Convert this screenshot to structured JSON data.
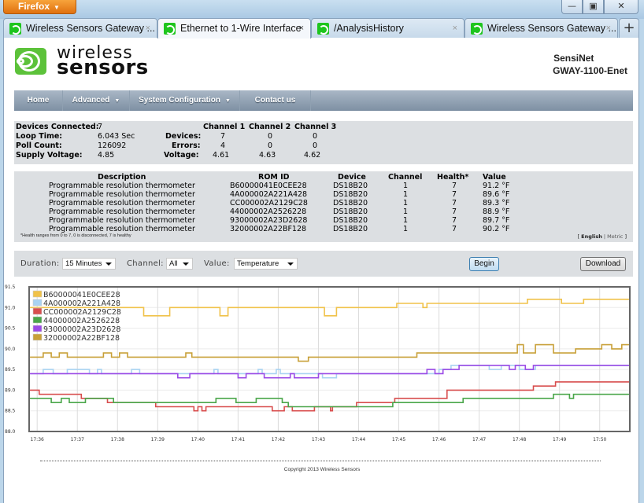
{
  "browser": {
    "app_button": "Firefox",
    "window_controls": {
      "minimize": "▭",
      "maximize": "□",
      "close": "✕"
    },
    "tabs": [
      {
        "title": "Wireless Sensors Gateway ...",
        "active": false
      },
      {
        "title": "Ethernet to 1-Wire Interface",
        "active": true
      },
      {
        "title": "/AnalysisHistory",
        "active": false
      },
      {
        "title": "Wireless Sensors Gateway ...",
        "active": false
      }
    ],
    "tab_close": "×",
    "new_tab": "+"
  },
  "header": {
    "logo_line1": "wireless",
    "logo_line2": "sensors",
    "product": "SensiNet",
    "model": "GWAY-1100-Enet"
  },
  "nav": {
    "items": [
      {
        "label": "Home",
        "dropdown": false
      },
      {
        "label": "Advanced",
        "dropdown": true
      },
      {
        "label": "System Configuration",
        "dropdown": true
      },
      {
        "label": "Contact us",
        "dropdown": false
      }
    ],
    "caret": "▼"
  },
  "status": {
    "devices_connected_label": "Devices Connected:",
    "devices_connected": "7",
    "loop_time_label": "Loop Time:",
    "loop_time": "6.043 Sec",
    "poll_count_label": "Poll Count:",
    "poll_count": "126092",
    "supply_voltage_label": "Supply Voltage:",
    "supply_voltage": "4.85",
    "channel_headers": [
      "Channel 1",
      "Channel 2",
      "Channel 3"
    ],
    "row_labels": {
      "devices": "Devices:",
      "errors": "Errors:",
      "voltage": "Voltage:"
    },
    "channels": [
      {
        "devices": "7",
        "errors": "4",
        "voltage": "4.61"
      },
      {
        "devices": "0",
        "errors": "0",
        "voltage": "4.63"
      },
      {
        "devices": "0",
        "errors": "0",
        "voltage": "4.62"
      }
    ]
  },
  "devices_table": {
    "headers": {
      "description": "Description",
      "rom_id": "ROM ID",
      "device": "Device",
      "channel": "Channel",
      "health": "Health*",
      "value": "Value"
    },
    "rows": [
      {
        "description": "Programmable resolution thermometer",
        "rom_id": "B60000041E0CEE28",
        "device": "DS18B20",
        "channel": "1",
        "health": "7",
        "value": "91.2 °F"
      },
      {
        "description": "Programmable resolution thermometer",
        "rom_id": "4A000002A221A428",
        "device": "DS18B20",
        "channel": "1",
        "health": "7",
        "value": "89.6 °F"
      },
      {
        "description": "Programmable resolution thermometer",
        "rom_id": "CC000002A2129C28",
        "device": "DS18B20",
        "channel": "1",
        "health": "7",
        "value": "89.3 °F"
      },
      {
        "description": "Programmable resolution thermometer",
        "rom_id": "44000002A2526228",
        "device": "DS18B20",
        "channel": "1",
        "health": "7",
        "value": "88.9 °F"
      },
      {
        "description": "Programmable resolution thermometer",
        "rom_id": "93000002A23D2628",
        "device": "DS18B20",
        "channel": "1",
        "health": "7",
        "value": "89.7 °F"
      },
      {
        "description": "Programmable resolution thermometer",
        "rom_id": "32000002A22BF128",
        "device": "DS18B20",
        "channel": "1",
        "health": "7",
        "value": "90.2 °F"
      }
    ],
    "footnote": "*Health ranges from 0 to 7, 0 is disconnected, 7 is healthy",
    "units": {
      "open": "[ ",
      "english": "English",
      "sep": " | ",
      "metric": "Metric",
      "close": " ]"
    }
  },
  "controls": {
    "duration_label": "Duration:",
    "duration_value": "15 Minutes",
    "channel_label": "Channel:",
    "channel_value": "All",
    "value_label": "Value:",
    "value_value": "Temperature",
    "begin_button": "Begin",
    "download_button": "Download"
  },
  "chart_data": {
    "type": "line",
    "title": "",
    "xlabel": "",
    "ylabel": "",
    "ylim": [
      88.0,
      91.5
    ],
    "yticks": [
      "91.5",
      "91.0",
      "90.5",
      "90.0",
      "89.5",
      "89.0",
      "88.5",
      "88.0"
    ],
    "xticks": [
      "17:36",
      "17:37",
      "17:38",
      "17:39",
      "17:40",
      "17:41",
      "17:42",
      "17:43",
      "17:44",
      "17:45",
      "17:46",
      "17:47",
      "17:48",
      "17:49",
      "17:50"
    ],
    "xlim_minutes_after_1736": [
      -0.2,
      14.75
    ],
    "grid": true,
    "legend": "top-left",
    "step": true,
    "series": [
      {
        "name": "B60000041E0CEE28",
        "color": "#f0c24a",
        "points": [
          [
            -0.2,
            91.0
          ],
          [
            2.65,
            91.0
          ],
          [
            2.65,
            90.8
          ],
          [
            3.3,
            90.8
          ],
          [
            3.3,
            91.0
          ],
          [
            4.55,
            91.0
          ],
          [
            4.55,
            90.8
          ],
          [
            4.75,
            90.8
          ],
          [
            4.75,
            91.0
          ],
          [
            7.15,
            91.0
          ],
          [
            7.15,
            90.8
          ],
          [
            7.45,
            90.8
          ],
          [
            7.45,
            91.0
          ],
          [
            8.95,
            91.0
          ],
          [
            8.95,
            91.1
          ],
          [
            9.6,
            91.1
          ],
          [
            9.6,
            91.0
          ],
          [
            9.7,
            91.0
          ],
          [
            9.7,
            91.1
          ],
          [
            12.2,
            91.1
          ],
          [
            12.2,
            91.2
          ],
          [
            13.05,
            91.2
          ],
          [
            13.05,
            91.1
          ],
          [
            13.6,
            91.1
          ],
          [
            13.6,
            91.2
          ],
          [
            14.75,
            91.2
          ]
        ]
      },
      {
        "name": "4A000002A221A428",
        "color": "#a9d3f2",
        "points": [
          [
            -0.2,
            89.4
          ],
          [
            0.15,
            89.4
          ],
          [
            0.15,
            89.5
          ],
          [
            0.4,
            89.5
          ],
          [
            0.4,
            89.4
          ],
          [
            0.75,
            89.4
          ],
          [
            0.75,
            89.5
          ],
          [
            1.3,
            89.5
          ],
          [
            1.3,
            89.4
          ],
          [
            1.5,
            89.4
          ],
          [
            1.5,
            89.5
          ],
          [
            1.6,
            89.5
          ],
          [
            1.6,
            89.4
          ],
          [
            2.35,
            89.4
          ],
          [
            2.35,
            89.5
          ],
          [
            2.55,
            89.5
          ],
          [
            2.55,
            89.4
          ],
          [
            4.4,
            89.4
          ],
          [
            4.4,
            89.5
          ],
          [
            4.5,
            89.5
          ],
          [
            4.5,
            89.4
          ],
          [
            5.5,
            89.4
          ],
          [
            5.5,
            89.5
          ],
          [
            5.6,
            89.5
          ],
          [
            5.6,
            89.4
          ],
          [
            5.95,
            89.4
          ],
          [
            5.95,
            89.5
          ],
          [
            6.05,
            89.5
          ],
          [
            6.05,
            89.4
          ],
          [
            7.1,
            89.4
          ],
          [
            7.1,
            89.3
          ],
          [
            7.45,
            89.3
          ],
          [
            7.45,
            89.4
          ],
          [
            10.0,
            89.4
          ],
          [
            10.0,
            89.5
          ],
          [
            10.3,
            89.5
          ],
          [
            10.3,
            89.6
          ],
          [
            11.25,
            89.6
          ],
          [
            11.25,
            89.5
          ],
          [
            11.55,
            89.5
          ],
          [
            11.55,
            89.6
          ],
          [
            12.0,
            89.6
          ],
          [
            12.0,
            89.5
          ],
          [
            12.4,
            89.5
          ],
          [
            12.4,
            89.6
          ],
          [
            14.75,
            89.6
          ]
        ]
      },
      {
        "name": "CC000002A2129C28",
        "color": "#d84e4e",
        "points": [
          [
            -0.2,
            89.0
          ],
          [
            0.05,
            89.0
          ],
          [
            0.05,
            88.9
          ],
          [
            1.1,
            88.9
          ],
          [
            1.1,
            88.8
          ],
          [
            1.75,
            88.8
          ],
          [
            1.75,
            88.7
          ],
          [
            2.95,
            88.7
          ],
          [
            2.95,
            88.6
          ],
          [
            3.9,
            88.6
          ],
          [
            3.9,
            88.5
          ],
          [
            4.0,
            88.5
          ],
          [
            4.0,
            88.6
          ],
          [
            4.1,
            88.6
          ],
          [
            4.1,
            88.5
          ],
          [
            4.2,
            88.5
          ],
          [
            4.2,
            88.6
          ],
          [
            5.85,
            88.6
          ],
          [
            5.85,
            88.5
          ],
          [
            6.15,
            88.5
          ],
          [
            6.15,
            88.6
          ],
          [
            6.35,
            88.6
          ],
          [
            6.35,
            88.5
          ],
          [
            6.9,
            88.5
          ],
          [
            6.9,
            88.6
          ],
          [
            7.3,
            88.6
          ],
          [
            7.3,
            88.5
          ],
          [
            7.35,
            88.5
          ],
          [
            7.35,
            88.6
          ],
          [
            7.95,
            88.6
          ],
          [
            7.95,
            88.7
          ],
          [
            8.9,
            88.7
          ],
          [
            8.9,
            88.8
          ],
          [
            10.2,
            88.8
          ],
          [
            10.2,
            89.0
          ],
          [
            12.35,
            89.0
          ],
          [
            12.35,
            89.1
          ],
          [
            12.9,
            89.1
          ],
          [
            12.9,
            89.2
          ],
          [
            14.75,
            89.2
          ]
        ]
      },
      {
        "name": "44000002A2526228",
        "color": "#4aa64a",
        "points": [
          [
            -0.2,
            88.8
          ],
          [
            0.35,
            88.8
          ],
          [
            0.35,
            88.7
          ],
          [
            0.6,
            88.7
          ],
          [
            0.6,
            88.8
          ],
          [
            0.8,
            88.8
          ],
          [
            0.8,
            88.7
          ],
          [
            1.2,
            88.7
          ],
          [
            1.2,
            88.8
          ],
          [
            1.9,
            88.8
          ],
          [
            1.9,
            88.7
          ],
          [
            4.45,
            88.7
          ],
          [
            4.45,
            88.8
          ],
          [
            4.95,
            88.8
          ],
          [
            4.95,
            88.7
          ],
          [
            5.45,
            88.7
          ],
          [
            5.45,
            88.8
          ],
          [
            6.1,
            88.8
          ],
          [
            6.1,
            88.7
          ],
          [
            6.25,
            88.7
          ],
          [
            6.25,
            88.6
          ],
          [
            8.85,
            88.6
          ],
          [
            8.85,
            88.7
          ],
          [
            10.6,
            88.7
          ],
          [
            10.6,
            88.8
          ],
          [
            12.85,
            88.8
          ],
          [
            12.85,
            88.9
          ],
          [
            13.25,
            88.9
          ],
          [
            13.25,
            88.8
          ],
          [
            13.35,
            88.8
          ],
          [
            13.35,
            88.9
          ],
          [
            14.75,
            88.9
          ]
        ]
      },
      {
        "name": "93000002A23D2628",
        "color": "#9b4ae6",
        "points": [
          [
            -0.2,
            89.4
          ],
          [
            3.5,
            89.4
          ],
          [
            3.5,
            89.3
          ],
          [
            3.8,
            89.3
          ],
          [
            3.8,
            89.4
          ],
          [
            5.0,
            89.4
          ],
          [
            5.0,
            89.3
          ],
          [
            5.2,
            89.3
          ],
          [
            5.2,
            89.4
          ],
          [
            5.65,
            89.4
          ],
          [
            5.65,
            89.3
          ],
          [
            6.3,
            89.3
          ],
          [
            6.3,
            89.4
          ],
          [
            6.4,
            89.4
          ],
          [
            6.4,
            89.3
          ],
          [
            7.0,
            89.3
          ],
          [
            7.0,
            89.4
          ],
          [
            7.45,
            89.4
          ],
          [
            7.45,
            89.4
          ],
          [
            9.7,
            89.4
          ],
          [
            9.7,
            89.5
          ],
          [
            9.9,
            89.5
          ],
          [
            9.9,
            89.4
          ],
          [
            10.1,
            89.4
          ],
          [
            10.1,
            89.5
          ],
          [
            10.5,
            89.5
          ],
          [
            10.5,
            89.6
          ],
          [
            11.75,
            89.6
          ],
          [
            11.75,
            89.5
          ],
          [
            11.9,
            89.5
          ],
          [
            11.9,
            89.6
          ],
          [
            12.15,
            89.6
          ],
          [
            12.15,
            89.5
          ],
          [
            12.35,
            89.5
          ],
          [
            12.35,
            89.6
          ],
          [
            14.75,
            89.6
          ]
        ]
      },
      {
        "name": "32000002A22BF128",
        "color": "#c8a038",
        "points": [
          [
            -0.2,
            89.8
          ],
          [
            0.15,
            89.8
          ],
          [
            0.15,
            89.9
          ],
          [
            0.35,
            89.9
          ],
          [
            0.35,
            89.8
          ],
          [
            0.55,
            89.8
          ],
          [
            0.55,
            89.9
          ],
          [
            0.75,
            89.9
          ],
          [
            0.75,
            89.8
          ],
          [
            1.65,
            89.8
          ],
          [
            1.65,
            89.9
          ],
          [
            1.85,
            89.9
          ],
          [
            1.85,
            89.8
          ],
          [
            2.05,
            89.8
          ],
          [
            2.05,
            89.9
          ],
          [
            2.25,
            89.9
          ],
          [
            2.25,
            89.8
          ],
          [
            3.7,
            89.8
          ],
          [
            3.7,
            89.9
          ],
          [
            3.85,
            89.9
          ],
          [
            3.85,
            89.8
          ],
          [
            6.5,
            89.8
          ],
          [
            6.5,
            89.7
          ],
          [
            6.75,
            89.7
          ],
          [
            6.75,
            89.8
          ],
          [
            9.45,
            89.8
          ],
          [
            9.45,
            89.9
          ],
          [
            11.95,
            89.9
          ],
          [
            11.95,
            90.1
          ],
          [
            12.1,
            90.1
          ],
          [
            12.1,
            89.9
          ],
          [
            12.4,
            89.9
          ],
          [
            12.4,
            90.1
          ],
          [
            12.85,
            90.1
          ],
          [
            12.85,
            89.9
          ],
          [
            13.4,
            89.9
          ],
          [
            13.4,
            90.0
          ],
          [
            14.05,
            90.0
          ],
          [
            14.05,
            90.1
          ],
          [
            14.3,
            90.1
          ],
          [
            14.3,
            90.0
          ],
          [
            14.55,
            90.0
          ],
          [
            14.55,
            90.1
          ],
          [
            14.75,
            90.1
          ]
        ]
      }
    ]
  },
  "footer": {
    "copyright": "Copyright 2013 Wireless Sensors"
  }
}
